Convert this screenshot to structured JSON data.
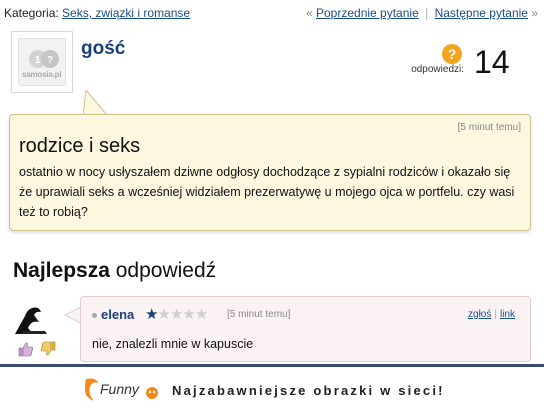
{
  "nav": {
    "category_label": "Kategoria:",
    "category_link": "Seks, związki i romanse",
    "prev_arrow": "«",
    "prev_link": "Poprzednie pytanie",
    "separator": "|",
    "next_link": "Następne pytanie",
    "next_arrow": "»"
  },
  "question": {
    "author": "gość",
    "avatar_logo_text": "samosia.pl",
    "answers_icon": "?",
    "answers_label": "odpowiedzi:",
    "answers_count": "14",
    "time": "[5 minut temu]",
    "title": "rodzice i seks",
    "body": "ostatnio w nocy usłyszałem dziwne odgłosy dochodzące z sypialni rodziców i okazało się że uprawiali seks a wcześniej widziałem prezerwatywę u mojego ojca w portfelu. czy wasi też to robią?"
  },
  "best_answer": {
    "heading_bold": "Najlepsza",
    "heading_rest": " odpowiedź",
    "author": "elena",
    "rating": 1,
    "rating_max": 5,
    "time": "[5 minut temu]",
    "report_link": "zgłoś",
    "link_link": "link",
    "body": "nie, znalezli mnie w kapuscie",
    "thumb_up_icon": "thumbs-up-icon",
    "thumb_down_icon": "thumbs-down-icon"
  },
  "footer": {
    "logo_text": "Funny",
    "slogan": "Najzabawniejsze obrazki w sieci!"
  },
  "colors": {
    "link": "#1a4d8f",
    "question_bg": "#fcf7df",
    "answer_bg": "#fbf2f4",
    "badge": "#f0a51c",
    "footer_border": "#3b4b6e"
  }
}
